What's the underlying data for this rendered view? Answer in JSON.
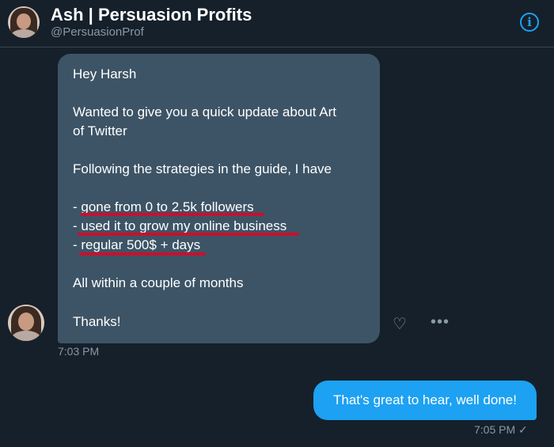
{
  "header": {
    "title": "Ash | Persuasion Profits",
    "handle": "@PersuasionProf",
    "info_icon": "info-icon"
  },
  "conversation": {
    "incoming_message": {
      "lines": [
        "Hey Harsh",
        "Wanted to give you a quick update about Art",
        "of Twitter",
        "Following the strategies in the guide, I have",
        "- gone from 0 to 2.5k followers",
        "- used it to grow my online business",
        "- regular 500$ + days",
        "All within a couple of months",
        "Thanks!"
      ],
      "timestamp": "7:03 PM"
    },
    "outgoing_message": {
      "text": "That's great to hear, well done!",
      "timestamp": "7:05 PM",
      "status_icon": "check-icon",
      "status_glyph": "✓"
    },
    "actions": {
      "react_icon": "heart-plus-icon",
      "more_icon": "more-icon",
      "react_glyph": "♡",
      "more_glyph": "•••"
    }
  },
  "colors": {
    "background": "#15202b",
    "incoming_bubble": "#3d5466",
    "outgoing_bubble": "#1da1f2",
    "accent": "#1da1f2",
    "underline": "#c8102e",
    "muted_text": "#8899a6"
  }
}
